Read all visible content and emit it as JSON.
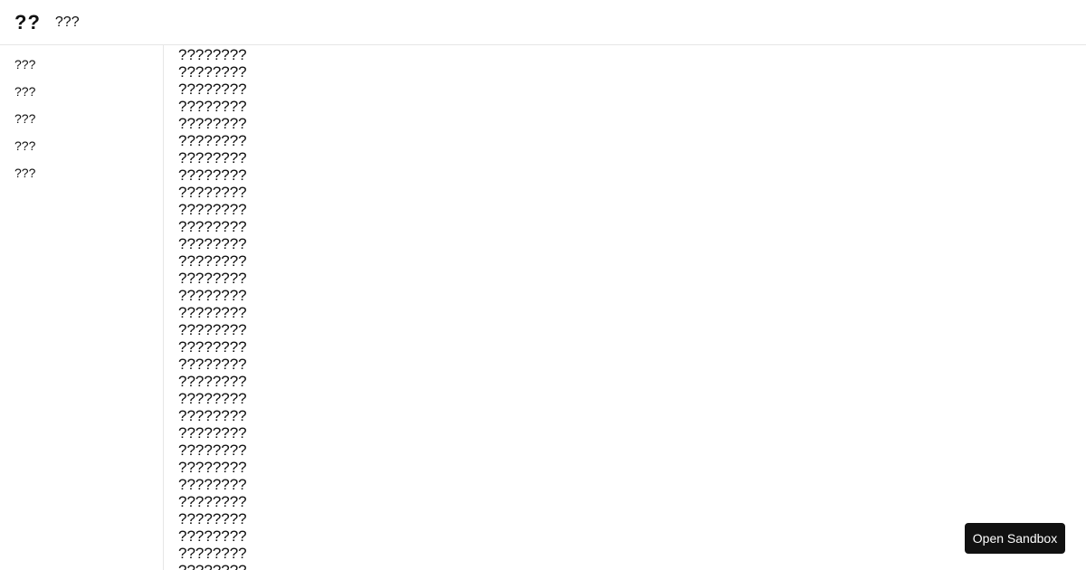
{
  "header": {
    "logo": "??",
    "title": "???"
  },
  "sidebar": {
    "items": [
      {
        "label": "???"
      },
      {
        "label": "???"
      },
      {
        "label": "???"
      },
      {
        "label": "???"
      },
      {
        "label": "???"
      }
    ]
  },
  "main": {
    "lines": [
      "????????",
      "????????",
      "????????",
      "????????",
      "????????",
      "????????",
      "????????",
      "????????",
      "????????",
      "????????",
      "????????",
      "????????",
      "????????",
      "????????",
      "????????",
      "????????",
      "????????",
      "????????",
      "????????",
      "????????",
      "????????",
      "????????",
      "????????",
      "????????",
      "????????",
      "????????",
      "????????",
      "????????",
      "????????",
      "????????",
      "????????"
    ]
  },
  "sandbox_button": {
    "label": "Open Sandbox"
  }
}
